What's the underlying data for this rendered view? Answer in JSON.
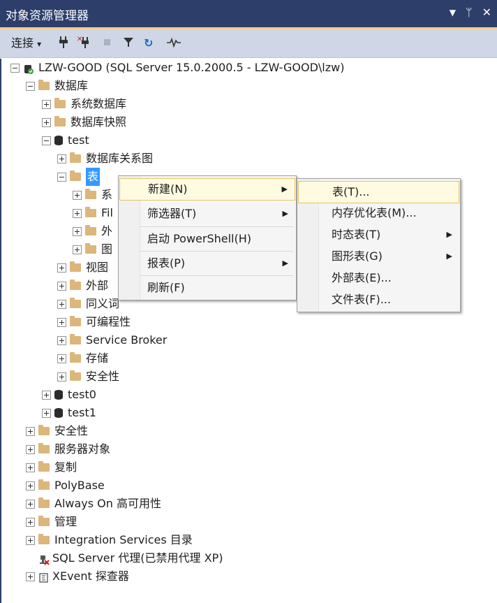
{
  "window": {
    "title": "对象资源管理器",
    "pin_glyph": "▼",
    "pin2_glyph": "ᛘ",
    "close_glyph": "✕"
  },
  "toolbar": {
    "connect_label": "连接",
    "dropdown_glyph": "▾",
    "refresh_glyph": "↻",
    "filter_glyph": "▼",
    "activity_glyph": "⌁"
  },
  "tree": [
    {
      "label": "LZW-GOOD (SQL Server 15.0.2000.5 - LZW-GOOD\\lzw)",
      "icon": "server"
    },
    {
      "label": "数据库",
      "icon": "folder"
    },
    {
      "label": "系统数据库",
      "icon": "folder"
    },
    {
      "label": "数据库快照",
      "icon": "folder"
    },
    {
      "label": "test",
      "icon": "database"
    },
    {
      "label": "数据库关系图",
      "icon": "folder"
    },
    {
      "label": "表",
      "icon": "folder"
    },
    {
      "label": "系",
      "icon": "folder"
    },
    {
      "label": "Fil",
      "icon": "folder"
    },
    {
      "label": "外",
      "icon": "folder"
    },
    {
      "label": "图",
      "icon": "folder"
    },
    {
      "label": "视图",
      "icon": "folder"
    },
    {
      "label": "外部",
      "icon": "folder"
    },
    {
      "label": "同义词",
      "icon": "folder"
    },
    {
      "label": "可编程性",
      "icon": "folder"
    },
    {
      "label": "Service Broker",
      "icon": "folder"
    },
    {
      "label": "存储",
      "icon": "folder"
    },
    {
      "label": "安全性",
      "icon": "folder"
    },
    {
      "label": "test0",
      "icon": "database"
    },
    {
      "label": "test1",
      "icon": "database"
    },
    {
      "label": "安全性",
      "icon": "folder"
    },
    {
      "label": "服务器对象",
      "icon": "folder"
    },
    {
      "label": "复制",
      "icon": "folder"
    },
    {
      "label": "PolyBase",
      "icon": "folder"
    },
    {
      "label": "Always On 高可用性",
      "icon": "folder"
    },
    {
      "label": "管理",
      "icon": "folder"
    },
    {
      "label": "Integration Services 目录",
      "icon": "folder"
    },
    {
      "label": "SQL Server 代理(已禁用代理 XP)",
      "icon": "agent"
    },
    {
      "label": "XEvent 探查器",
      "icon": "xevent"
    }
  ],
  "context_menu": {
    "items": [
      "新建(N)",
      "筛选器(T)",
      "启动 PowerShell(H)",
      "报表(P)",
      "刷新(F)"
    ],
    "arrow_glyph": "▶"
  },
  "submenu": {
    "items": [
      "表(T)...",
      "内存优化表(M)...",
      "时态表(T)",
      "图形表(G)",
      "外部表(E)...",
      "文件表(F)..."
    ]
  }
}
